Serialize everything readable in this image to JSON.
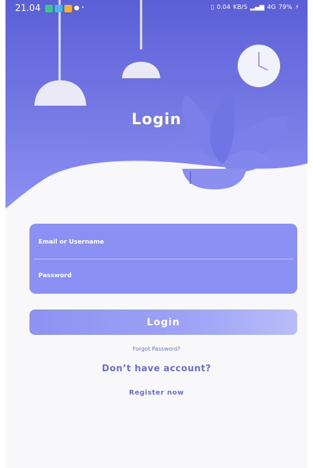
{
  "status_bar": {
    "time": "21.04",
    "net_speed": "0.04",
    "net_unit": "KB/S",
    "network": "4G",
    "battery": "79%"
  },
  "header": {
    "title": "Login"
  },
  "form": {
    "username_label": "Email or Username",
    "password_label": "Password"
  },
  "actions": {
    "login_label": "Login",
    "forgot_label": "Forgot Password?",
    "no_account_label": "Don’t have account?",
    "register_label": "Register now"
  },
  "colors": {
    "hero_top": "#5b5fd6",
    "hero_bottom": "#8c90f2",
    "card": "#8b91f4",
    "accent_text": "#6a6fd6"
  }
}
